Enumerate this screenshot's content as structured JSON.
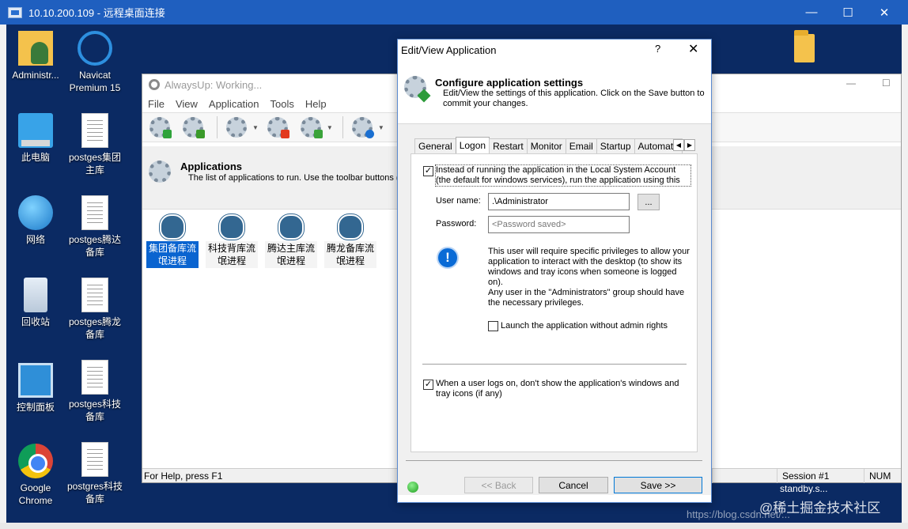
{
  "rdp": {
    "title": "10.10.200.109 - 远程桌面连接",
    "minimize": "—",
    "maximize": "☐",
    "close": "✕"
  },
  "desktop": {
    "icons": [
      {
        "label": "Administr...",
        "icon": "user-folder-icon"
      },
      {
        "label": "Navicat Premium 15",
        "icon": "navicat-icon"
      },
      {
        "label": "此电脑",
        "icon": "computer-icon"
      },
      {
        "label": "postges集团主库",
        "icon": "document-icon"
      },
      {
        "label": "网络",
        "icon": "network-icon"
      },
      {
        "label": "postges腾达备库",
        "icon": "document-icon"
      },
      {
        "label": "回收站",
        "icon": "recycle-bin-icon"
      },
      {
        "label": "postges腾龙备库",
        "icon": "document-icon"
      },
      {
        "label": "控制面板",
        "icon": "control-panel-icon"
      },
      {
        "label": "postges科技备库",
        "icon": "document-icon"
      },
      {
        "label": "Google Chrome",
        "icon": "chrome-icon"
      },
      {
        "label": "postgres科技备库",
        "icon": "document-icon"
      }
    ],
    "bg_text": "standby.s...",
    "watermark": "@稀土掘金技术社区",
    "watermark2": "https://blog.csdn.net/..."
  },
  "alwaysup": {
    "title": "AlwaysUp: Working...",
    "menu": [
      "File",
      "View",
      "Application",
      "Tools",
      "Help"
    ],
    "header_title": "Applications",
    "header_desc": "The list of applications to run. Use the toolbar buttons (",
    "apps": [
      {
        "label": "集团备库流氓进程",
        "selected": true
      },
      {
        "label": "科技背库流氓进程",
        "selected": false
      },
      {
        "label": "腾达主库流氓进程",
        "selected": false
      },
      {
        "label": "腾龙备库流氓进程",
        "selected": false
      }
    ],
    "status_help": "For Help, press F1",
    "status_session": "Session #1",
    "status_num": "NUM"
  },
  "dialog": {
    "title": "Edit/View Application",
    "help": "?",
    "close": "✕",
    "head_title": "Configure application settings",
    "head_desc": "Edit/View the settings of this application. Click on the Save button to commit your changes.",
    "tabs": [
      "General",
      "Logon",
      "Restart",
      "Monitor",
      "Email",
      "Startup",
      "Automate"
    ],
    "active_tab": "Logon",
    "run_as_checked": true,
    "run_as_text": "Instead of running the application in the Local System Account (the default for windows services), run the application using this",
    "username_label": "User name:",
    "username_value": ".\\Administrator",
    "browse_label": "...",
    "password_label": "Password:",
    "password_placeholder": "<Password saved>",
    "info_text_1": "This user will require specific privileges to allow your application to interact with the desktop (to show its windows and tray icons when someone is logged on).",
    "info_text_2": "Any user in the \"Administrators\" group should have the necessary privileges.",
    "launch_checked": false,
    "launch_text": "Launch the application without admin rights",
    "hide_checked": true,
    "hide_text": "When a user logs on, don't show the application's windows and tray icons (if any)",
    "back_label": "<< Back",
    "cancel_label": "Cancel",
    "save_label": "Save >>"
  }
}
